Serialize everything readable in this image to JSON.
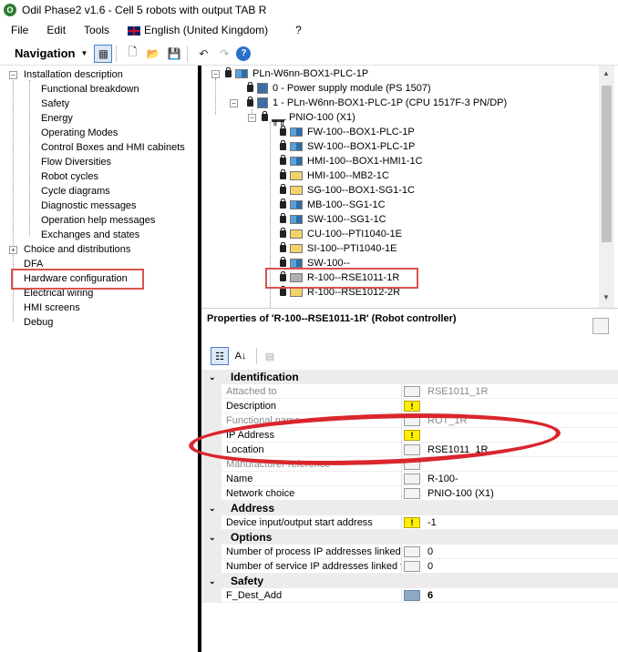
{
  "app": {
    "title": "Odil Phase2 v1.6 - Cell 5 robots with output TAB R",
    "icon_letter": "O"
  },
  "menubar": {
    "items": [
      "File",
      "Edit",
      "Tools"
    ],
    "language": "English (United Kingdom)",
    "help": "?"
  },
  "toolbar": {
    "navigation_label": "Navigation"
  },
  "left_tree": {
    "root": "Installation description",
    "children": [
      "Functional breakdown",
      "Safety",
      "Energy",
      "Operating Modes",
      "Control Boxes and HMI cabinets",
      "Flow Diversities",
      "Robot cycles",
      "Cycle diagrams",
      "Diagnostic messages",
      "Operation help messages",
      "Exchanges and states"
    ],
    "others": [
      "Choice and distributions",
      "DFA",
      "Hardware configuration",
      "Electrical wiring",
      "HMI screens",
      "Debug"
    ],
    "selected": "Hardware configuration"
  },
  "device_tree": {
    "root": "PLn-W6nn-BOX1-PLC-1P",
    "level1": [
      "0 - Power supply module (PS 1507)",
      "1 - PLn-W6nn-BOX1-PLC-1P (CPU 1517F-3 PN/DP)"
    ],
    "network": "PNIO-100 (X1)",
    "devices": [
      "FW-100--BOX1-PLC-1P",
      "SW-100--BOX1-PLC-1P",
      "HMI-100--BOX1-HMI1-1C",
      "HMI-100--MB2-1C",
      "SG-100--BOX1-SG1-1C",
      "MB-100--SG1-1C",
      "SW-100--SG1-1C",
      "CU-100--PTI1040-1E",
      "SI-100--PTI1040-1E",
      "SW-100--",
      "R-100--RSE1011-1R",
      "R-100--RSE1012-2R"
    ],
    "selected": "R-100--RSE1011-1R"
  },
  "properties": {
    "title": "Properties of 'R-100--RSE1011-1R' (Robot controller)",
    "categories": [
      {
        "name": "Identification",
        "rows": [
          {
            "name": "Attached to",
            "value": "RSE1011_1R",
            "disabled": true,
            "warn": false
          },
          {
            "name": "Description",
            "value": "",
            "disabled": false,
            "warn": true
          },
          {
            "name": "Functional name",
            "value": "ROT_1R",
            "disabled": true,
            "warn": false
          },
          {
            "name": "IP Address",
            "value": "",
            "disabled": false,
            "warn": true
          },
          {
            "name": "Location",
            "value": "RSE1011_1R",
            "disabled": true,
            "warn": false
          },
          {
            "name": "Manufacturer reference",
            "value": "",
            "disabled": true,
            "warn": false
          },
          {
            "name": "Name",
            "value": "R-100-",
            "disabled": false,
            "warn": false
          },
          {
            "name": "Network choice",
            "value": "PNIO-100 (X1)",
            "disabled": false,
            "warn": false
          }
        ]
      },
      {
        "name": "Address",
        "rows": [
          {
            "name": "Device input/output start address",
            "value": "-1",
            "disabled": false,
            "warn": true
          }
        ]
      },
      {
        "name": "Options",
        "rows": [
          {
            "name": "Number of process IP addresses linked to",
            "value": "0",
            "disabled": false,
            "warn": false
          },
          {
            "name": "Number of service IP addresses linked to",
            "value": "0",
            "disabled": false,
            "warn": false
          }
        ]
      },
      {
        "name": "Safety",
        "rows": [
          {
            "name": "F_Dest_Add",
            "value": "6",
            "disabled": false,
            "warn": false,
            "bold": true
          }
        ]
      }
    ],
    "warn_symbol": "!"
  },
  "colors": {
    "highlight_red": "#d9534f",
    "warn_yellow": "#ffef00",
    "category_bg": "#ececec"
  }
}
